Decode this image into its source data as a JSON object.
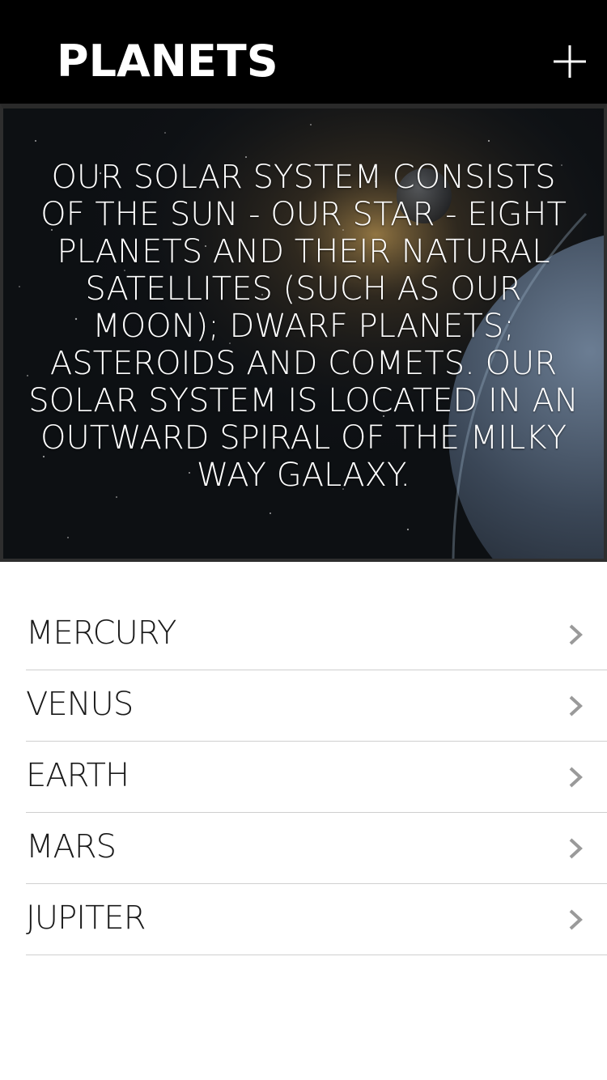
{
  "header": {
    "title": "PLANETS",
    "add_icon": "plus-icon"
  },
  "hero": {
    "text": "OUR SOLAR SYSTEM CONSISTS OF THE SUN - OUR STAR - EIGHT PLANETS AND THEIR NATURAL SATELLITES (SUCH AS OUR MOON); DWARF PLANETS; ASTEROIDS AND COMETS. OUR SOLAR SYSTEM IS LOCATED IN AN OUTWARD SPIRAL OF THE MILKY WAY GALAXY."
  },
  "planets": [
    {
      "name": "MERCURY",
      "icon": "chevron-right-icon"
    },
    {
      "name": "VENUS",
      "icon": "chevron-right-icon"
    },
    {
      "name": "EARTH",
      "icon": "chevron-right-icon"
    },
    {
      "name": "MARS",
      "icon": "chevron-right-icon"
    },
    {
      "name": "JUPITER",
      "icon": "chevron-right-icon"
    }
  ],
  "colors": {
    "header_bg": "#000000",
    "header_text": "#ffffff",
    "list_text": "#1a1a1a",
    "divider": "#cfcfcf",
    "chevron": "#9a9a9a"
  }
}
